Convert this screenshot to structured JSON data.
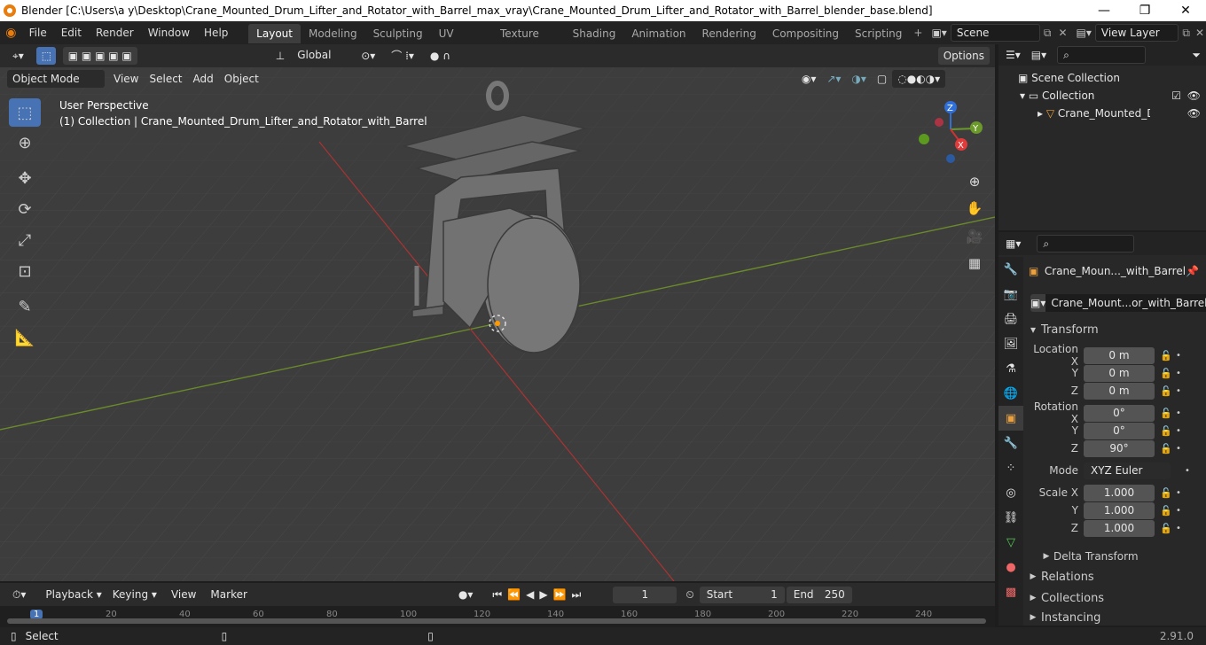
{
  "window": {
    "title": "Blender [C:\\Users\\a y\\Desktop\\Crane_Mounted_Drum_Lifter_and_Rotator_with_Barrel_max_vray\\Crane_Mounted_Drum_Lifter_and_Rotator_with_Barrel_blender_base.blend]",
    "minimize": "—",
    "maximize": "❐",
    "close": "✕"
  },
  "menu": [
    "File",
    "Edit",
    "Render",
    "Window",
    "Help"
  ],
  "workspaces": [
    "Layout",
    "Modeling",
    "Sculpting",
    "UV Editing",
    "Texture Paint",
    "Shading",
    "Animation",
    "Rendering",
    "Compositing",
    "Scripting"
  ],
  "scene": {
    "name": "Scene",
    "view_layer": "View Layer"
  },
  "viewport_header": {
    "orientation": "Global",
    "options": "Options",
    "mode": "Object Mode",
    "menus": [
      "View",
      "Select",
      "Add",
      "Object"
    ]
  },
  "overlay_text": {
    "perspective": "User Perspective",
    "collection": "(1) Collection | Crane_Mounted_Drum_Lifter_and_Rotator_with_Barrel"
  },
  "gizmo": {
    "z": "Z",
    "y": "Y",
    "x": "X"
  },
  "outliner": {
    "scene_collection": "Scene Collection",
    "collection": "Collection",
    "object": "Crane_Mounted_Drui"
  },
  "properties": {
    "object_name": "Crane_Moun..._with_Barrel",
    "data_name": "Crane_Mount...or_with_Barrel",
    "transform": "Transform",
    "location_label": "Location X",
    "location": [
      "0 m",
      "0 m",
      "0 m"
    ],
    "rotation_label": "Rotation X",
    "rotation": [
      "0°",
      "0°",
      "90°"
    ],
    "mode_label": "Mode",
    "mode": "XYZ Euler",
    "scale_label": "Scale X",
    "scale": [
      "1.000",
      "1.000",
      "1.000"
    ],
    "y": "Y",
    "z": "Z",
    "delta": "Delta Transform",
    "relations": "Relations",
    "collections": "Collections",
    "instancing": "Instancing"
  },
  "timeline": {
    "menus": [
      "Playback",
      "Keying",
      "View",
      "Marker"
    ],
    "frame": "1",
    "start_label": "Start",
    "start": "1",
    "end_label": "End",
    "end": "250",
    "ticks": [
      "1",
      "20",
      "40",
      "60",
      "80",
      "100",
      "120",
      "140",
      "160",
      "180",
      "200",
      "220",
      "240"
    ]
  },
  "status": {
    "select": "Select",
    "version": "2.91.0"
  }
}
